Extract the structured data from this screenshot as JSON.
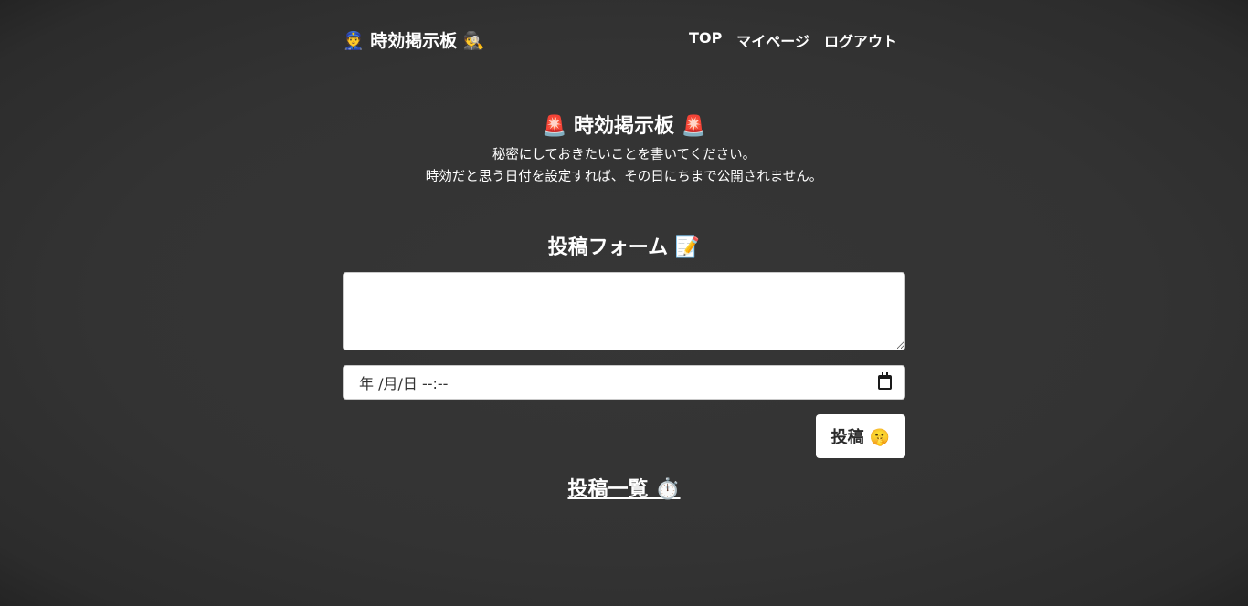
{
  "header": {
    "logo": "👮 時効掲示板 🕵️",
    "nav": {
      "top": "TOP",
      "mypage": "マイページ",
      "logout": "ログアウト"
    }
  },
  "hero": {
    "title": "🚨 時効掲示板 🚨",
    "description_line1": "秘密にしておきたいことを書いてください。",
    "description_line2": "時効だと思う日付を設定すれば、その日にちまで公開されません。"
  },
  "form": {
    "title": "投稿フォーム 📝",
    "textarea_value": "",
    "date_value": "年 /月/日 --:--",
    "submit_label": "投稿 🤫"
  },
  "list": {
    "link_label": "投稿一覧 ⏱️"
  }
}
